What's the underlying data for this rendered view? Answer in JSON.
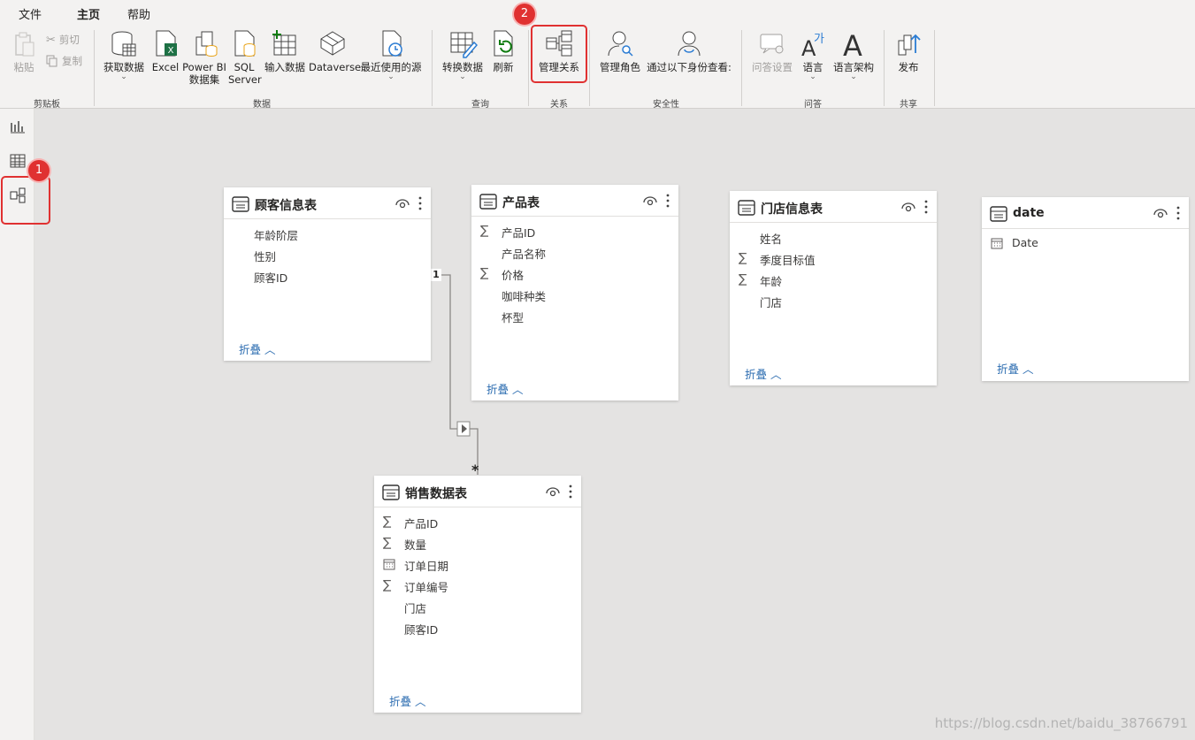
{
  "tabs": [
    "文件",
    "主页",
    "帮助"
  ],
  "ribbon": {
    "clipboard": {
      "paste": "粘贴",
      "cut": "剪切",
      "copy": "复制",
      "label": "剪贴板"
    },
    "data": {
      "get_data": "获取数据",
      "excel": "Excel",
      "powerbi_line1": "Power BI",
      "powerbi_line2": "数据集",
      "sql_line1": "SQL",
      "sql_line2": "Server",
      "enter_data": "输入数据",
      "dataverse": "Dataverse",
      "recent": "最近使用的源",
      "label": "数据"
    },
    "query": {
      "transform": "转换数据",
      "refresh": "刷新",
      "label": "查询"
    },
    "relationships": {
      "manage": "管理关系",
      "label": "关系"
    },
    "security": {
      "manage_roles": "管理角色",
      "view_as": "通过以下身份查看:",
      "label": "安全性"
    },
    "qa": {
      "qa_setup": "问答设置",
      "language": "语言",
      "linguistic": "语言架构",
      "label": "问答"
    },
    "share": {
      "publish": "发布",
      "label": "共享"
    }
  },
  "annotations": {
    "badge1": "1",
    "badge2": "2"
  },
  "tables": [
    {
      "title": "顾客信息表",
      "fields": [
        {
          "name": "年龄阶层",
          "icon": "none"
        },
        {
          "name": "性别",
          "icon": "none"
        },
        {
          "name": "顾客ID",
          "icon": "none"
        }
      ],
      "collapse": "折叠"
    },
    {
      "title": "产品表",
      "fields": [
        {
          "name": "产品ID",
          "icon": "sigma"
        },
        {
          "name": "产品名称",
          "icon": "none"
        },
        {
          "name": "价格",
          "icon": "sigma"
        },
        {
          "name": "咖啡种类",
          "icon": "none"
        },
        {
          "name": "杯型",
          "icon": "none"
        }
      ],
      "collapse": "折叠"
    },
    {
      "title": "门店信息表",
      "fields": [
        {
          "name": "姓名",
          "icon": "none"
        },
        {
          "name": "季度目标值",
          "icon": "sigma"
        },
        {
          "name": "年龄",
          "icon": "sigma"
        },
        {
          "name": "门店",
          "icon": "none"
        }
      ],
      "collapse": "折叠"
    },
    {
      "title": "date",
      "fields": [
        {
          "name": "Date",
          "icon": "calendar"
        }
      ],
      "collapse": "折叠"
    },
    {
      "title": "销售数据表",
      "fields": [
        {
          "name": "产品ID",
          "icon": "sigma"
        },
        {
          "name": "数量",
          "icon": "sigma"
        },
        {
          "name": "订单日期",
          "icon": "calendar"
        },
        {
          "name": "订单编号",
          "icon": "sigma"
        },
        {
          "name": "门店",
          "icon": "none"
        },
        {
          "name": "顾客ID",
          "icon": "none"
        }
      ],
      "collapse": "折叠"
    }
  ],
  "relationship": {
    "from_cardinality": "1",
    "to_cardinality": "*"
  },
  "watermark": "https://blog.csdn.net/baidu_38766791"
}
